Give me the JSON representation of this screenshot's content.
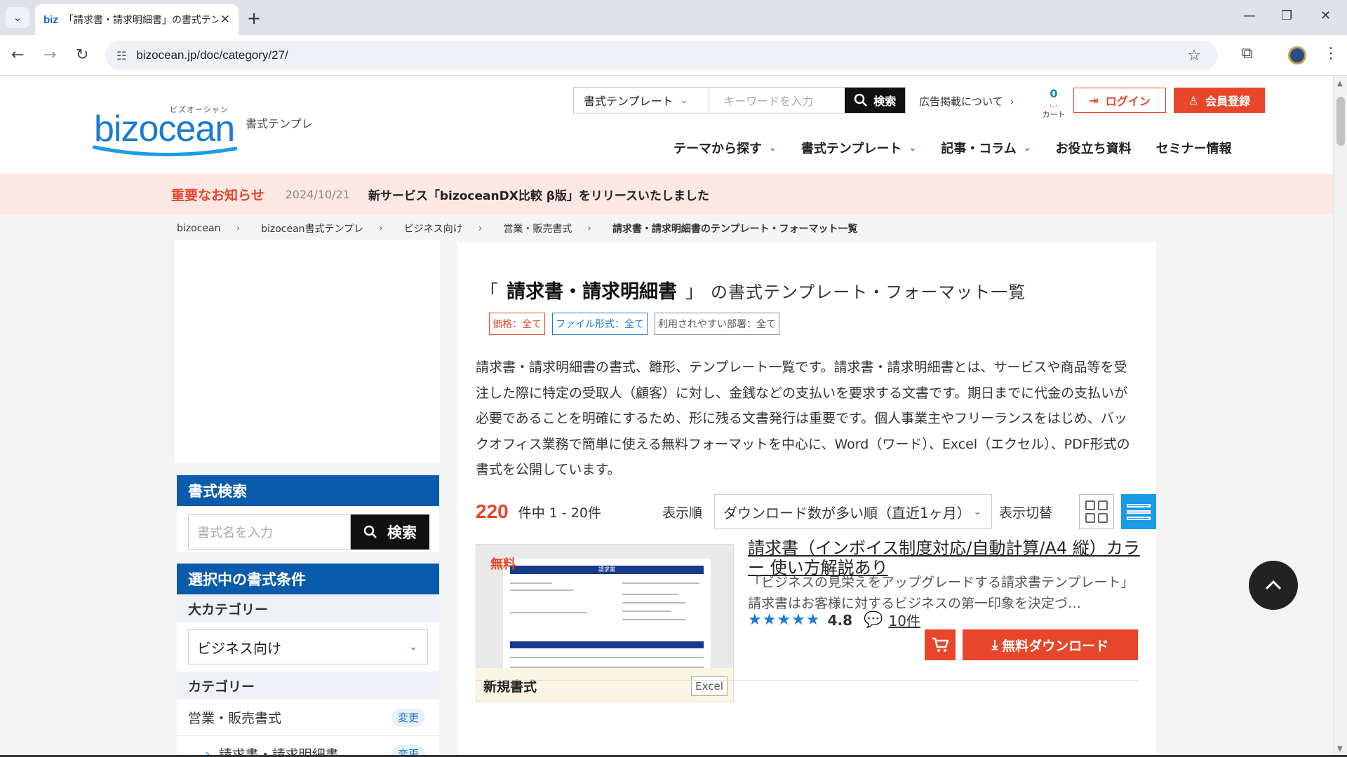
{
  "browser": {
    "tab_favicon": "biz",
    "tab_title": "「請求書・請求明細書」の書式テンプレート",
    "url": "bizocean.jp/doc/category/27/"
  },
  "header": {
    "logo_text": "bizocean",
    "logo_kana": "ビズオーシャン",
    "logo_sub": "書式テンプレ",
    "search_category": "書式テンプレート",
    "search_placeholder": "キーワードを入力",
    "search_button": "検索",
    "ad_link": "広告掲載について",
    "cart_count": "0",
    "cart_label": "カート",
    "login": "ログイン",
    "register": "会員登録",
    "nav": [
      "テーマから探す",
      "書式テンプレート",
      "記事・コラム",
      "お役立ち資料",
      "セミナー情報"
    ]
  },
  "notice": {
    "label": "重要なお知らせ",
    "date": "2024/10/21",
    "text": "新サービス「bizoceanDX比較 β版」をリリースいたしました"
  },
  "breadcrumb": [
    "bizocean",
    "bizocean書式テンプレ",
    "ビジネス向け",
    "営業・販売書式",
    "請求書・請求明細書のテンプレート・フォーマット一覧"
  ],
  "sidebar": {
    "search_title": "書式検索",
    "search_placeholder": "書式名を入力",
    "search_button": "検索",
    "cond_title": "選択中の書式条件",
    "major_label": "大カテゴリー",
    "major_value": "ビジネス向け",
    "category_label": "カテゴリー",
    "category_value": "営業・販売書式",
    "subcategory_value": "請求書・請求明細書",
    "change_label": "変更"
  },
  "main": {
    "bracket_open": "「",
    "category": "請求書・請求明細書",
    "bracket_close": "」",
    "heading_suffix": "の書式テンプレート・フォーマット一覧",
    "tag_price": "価格：全て",
    "tag_file": "ファイル形式：全て",
    "tag_dept": "利用されやすい部署：全て",
    "description": "請求書・請求明細書の書式、雛形、テンプレート一覧です。請求書・請求明細書とは、サービスや商品等を受注した際に特定の受取人（顧客）に対し、金銭などの支払いを要求する文書です。期日までに代金の支払いが必要であることを明確にするため、形に残る文書発行は重要です。個人事業主やフリーランスをはじめ、バックオフィス業務で簡単に使える無料フォーマットを中心に、Word（ワード）、Excel（エクセル）、PDF形式の書式を公開しています。",
    "count": "220",
    "count_text": "件中 1 - 20件",
    "sort_label": "表示順",
    "sort_value": "ダウンロード数が多い順（直近1ヶ月）",
    "view_label": "表示切替"
  },
  "doc": {
    "free_badge": "無料",
    "thumb_label": "新規書式",
    "file_type": "Excel",
    "thumb_header": "請求書",
    "title": "請求書（インボイス制度対応/自動計算/A4 縦）カラー 使い方解説あり",
    "description": "「ビジネスの見栄えをアップグレードする請求書テンプレート」 請求書はお客様に対するビジネスの第一印象を決定づ…",
    "rating": 4.8,
    "rating_text": "4.8",
    "reviews": "10件",
    "download": "無料ダウンロード"
  }
}
